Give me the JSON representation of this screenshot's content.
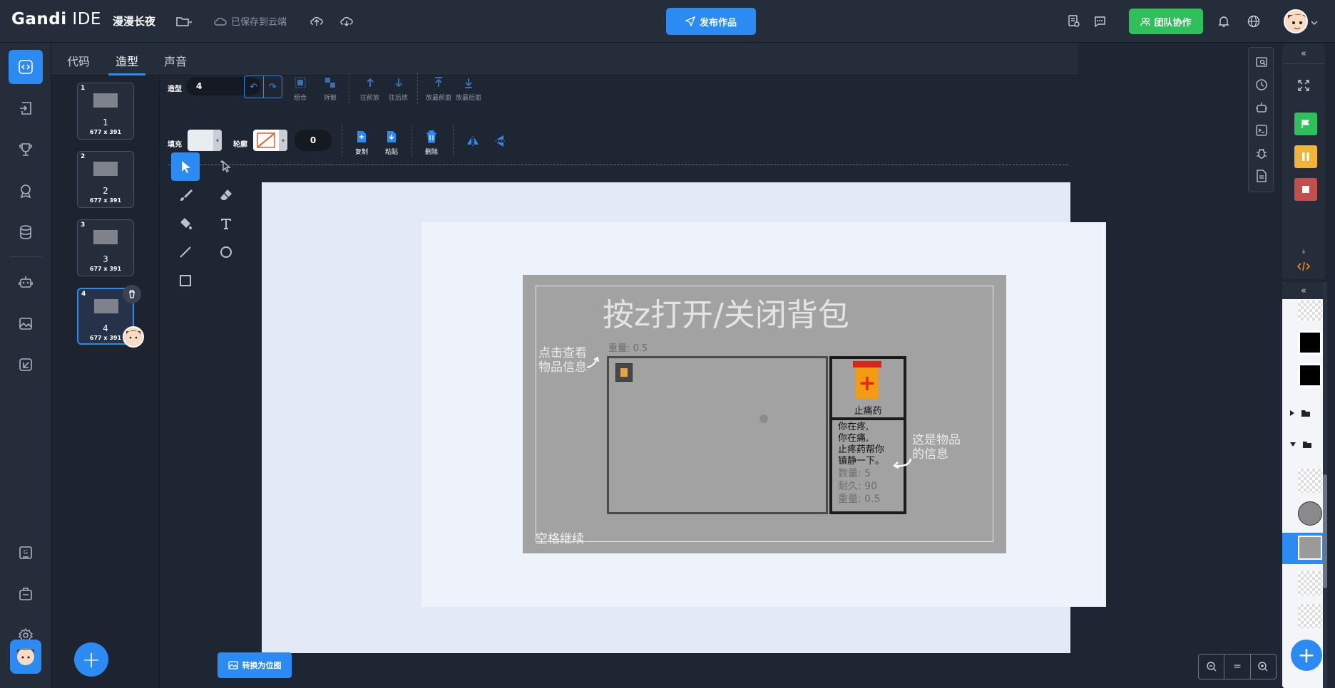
{
  "app": {
    "logo_main": "Gandi",
    "logo_sub": " IDE",
    "project_title": "漫漫长夜",
    "save_status": "已保存到云端",
    "publish_label": "发布作品",
    "team_label": "团队协作"
  },
  "tabs": [
    {
      "label": "代码"
    },
    {
      "label": "造型"
    },
    {
      "label": "声音"
    }
  ],
  "costumes": [
    {
      "num": "1",
      "name": "1",
      "size": "677 x 391"
    },
    {
      "num": "2",
      "name": "2",
      "size": "677 x 391"
    },
    {
      "num": "3",
      "name": "3",
      "size": "677 x 391"
    },
    {
      "num": "4",
      "name": "4",
      "size": "677 x 391"
    }
  ],
  "toolbar": {
    "costume_label": "造型",
    "costume_value": "4",
    "group": "组合",
    "ungroup": "拆散",
    "forward": "往前放",
    "backward": "往后放",
    "front": "放最前面",
    "back": "放最后面",
    "fill_label": "填充",
    "outline_label": "轮廓",
    "outline_width": "0",
    "copy": "复制",
    "paste": "粘贴",
    "delete": "删除"
  },
  "drawing": {
    "title": "按z打开/关闭背包",
    "weight_top": "重量: 0.5",
    "hint_left_1": "点击查看",
    "hint_left_2": "物品信息",
    "item_name": "止痛药",
    "desc_1": "你在疼,",
    "desc_2": "你在痛,",
    "desc_3": "止疼药帮你",
    "desc_4": "镇静一下。",
    "stat_count": "数量: 5",
    "stat_durability": "耐久: 90",
    "stat_weight": "重量: 0.5",
    "hint_right_1": "这是物品",
    "hint_right_2": "的信息",
    "continue": "空格继续"
  },
  "bottom": {
    "convert_label": "转换为位图",
    "zoom_out": "−",
    "zoom_reset": "=",
    "zoom_in": "+"
  },
  "colors": {
    "accent": "#2b8bf2",
    "team": "#2fbf5b",
    "flag": "#2fbf5b",
    "pause": "#f0b43a",
    "stop": "#c0504d"
  }
}
